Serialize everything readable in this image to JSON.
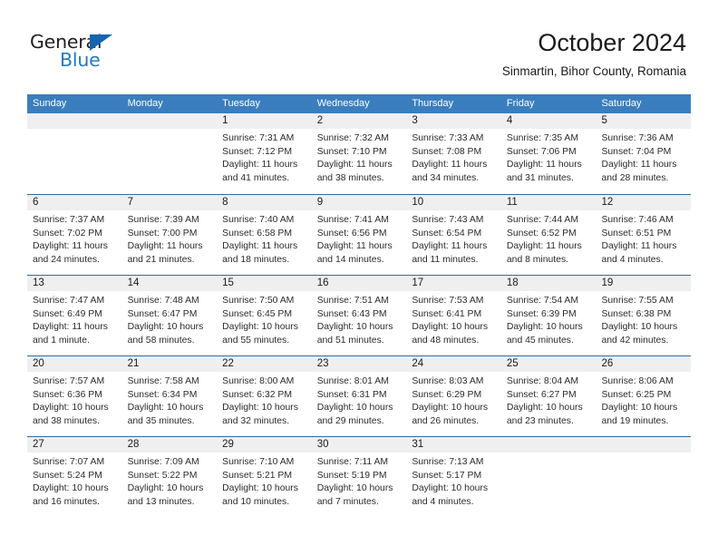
{
  "brand": {
    "name_top": "General",
    "name_bottom": "Blue",
    "color_dark": "#231f20",
    "color_blue": "#1f7ac4",
    "triangle_color": "#1566ae"
  },
  "header": {
    "title": "October 2024",
    "subtitle": "Sinmartin, Bihor County, Romania"
  },
  "theme": {
    "header_blue": "#3a7ebf",
    "row_separator_blue": "#2e6ca4",
    "daynum_band_gray": "#efefef"
  },
  "weekdays": [
    "Sunday",
    "Monday",
    "Tuesday",
    "Wednesday",
    "Thursday",
    "Friday",
    "Saturday"
  ],
  "weeks": [
    [
      {
        "day": "",
        "sunrise": "",
        "sunset": "",
        "daylight_1": "",
        "daylight_2": ""
      },
      {
        "day": "",
        "sunrise": "",
        "sunset": "",
        "daylight_1": "",
        "daylight_2": ""
      },
      {
        "day": "1",
        "sunrise": "Sunrise: 7:31 AM",
        "sunset": "Sunset: 7:12 PM",
        "daylight_1": "Daylight: 11 hours",
        "daylight_2": "and 41 minutes."
      },
      {
        "day": "2",
        "sunrise": "Sunrise: 7:32 AM",
        "sunset": "Sunset: 7:10 PM",
        "daylight_1": "Daylight: 11 hours",
        "daylight_2": "and 38 minutes."
      },
      {
        "day": "3",
        "sunrise": "Sunrise: 7:33 AM",
        "sunset": "Sunset: 7:08 PM",
        "daylight_1": "Daylight: 11 hours",
        "daylight_2": "and 34 minutes."
      },
      {
        "day": "4",
        "sunrise": "Sunrise: 7:35 AM",
        "sunset": "Sunset: 7:06 PM",
        "daylight_1": "Daylight: 11 hours",
        "daylight_2": "and 31 minutes."
      },
      {
        "day": "5",
        "sunrise": "Sunrise: 7:36 AM",
        "sunset": "Sunset: 7:04 PM",
        "daylight_1": "Daylight: 11 hours",
        "daylight_2": "and 28 minutes."
      }
    ],
    [
      {
        "day": "6",
        "sunrise": "Sunrise: 7:37 AM",
        "sunset": "Sunset: 7:02 PM",
        "daylight_1": "Daylight: 11 hours",
        "daylight_2": "and 24 minutes."
      },
      {
        "day": "7",
        "sunrise": "Sunrise: 7:39 AM",
        "sunset": "Sunset: 7:00 PM",
        "daylight_1": "Daylight: 11 hours",
        "daylight_2": "and 21 minutes."
      },
      {
        "day": "8",
        "sunrise": "Sunrise: 7:40 AM",
        "sunset": "Sunset: 6:58 PM",
        "daylight_1": "Daylight: 11 hours",
        "daylight_2": "and 18 minutes."
      },
      {
        "day": "9",
        "sunrise": "Sunrise: 7:41 AM",
        "sunset": "Sunset: 6:56 PM",
        "daylight_1": "Daylight: 11 hours",
        "daylight_2": "and 14 minutes."
      },
      {
        "day": "10",
        "sunrise": "Sunrise: 7:43 AM",
        "sunset": "Sunset: 6:54 PM",
        "daylight_1": "Daylight: 11 hours",
        "daylight_2": "and 11 minutes."
      },
      {
        "day": "11",
        "sunrise": "Sunrise: 7:44 AM",
        "sunset": "Sunset: 6:52 PM",
        "daylight_1": "Daylight: 11 hours",
        "daylight_2": "and 8 minutes."
      },
      {
        "day": "12",
        "sunrise": "Sunrise: 7:46 AM",
        "sunset": "Sunset: 6:51 PM",
        "daylight_1": "Daylight: 11 hours",
        "daylight_2": "and 4 minutes."
      }
    ],
    [
      {
        "day": "13",
        "sunrise": "Sunrise: 7:47 AM",
        "sunset": "Sunset: 6:49 PM",
        "daylight_1": "Daylight: 11 hours",
        "daylight_2": "and 1 minute."
      },
      {
        "day": "14",
        "sunrise": "Sunrise: 7:48 AM",
        "sunset": "Sunset: 6:47 PM",
        "daylight_1": "Daylight: 10 hours",
        "daylight_2": "and 58 minutes."
      },
      {
        "day": "15",
        "sunrise": "Sunrise: 7:50 AM",
        "sunset": "Sunset: 6:45 PM",
        "daylight_1": "Daylight: 10 hours",
        "daylight_2": "and 55 minutes."
      },
      {
        "day": "16",
        "sunrise": "Sunrise: 7:51 AM",
        "sunset": "Sunset: 6:43 PM",
        "daylight_1": "Daylight: 10 hours",
        "daylight_2": "and 51 minutes."
      },
      {
        "day": "17",
        "sunrise": "Sunrise: 7:53 AM",
        "sunset": "Sunset: 6:41 PM",
        "daylight_1": "Daylight: 10 hours",
        "daylight_2": "and 48 minutes."
      },
      {
        "day": "18",
        "sunrise": "Sunrise: 7:54 AM",
        "sunset": "Sunset: 6:39 PM",
        "daylight_1": "Daylight: 10 hours",
        "daylight_2": "and 45 minutes."
      },
      {
        "day": "19",
        "sunrise": "Sunrise: 7:55 AM",
        "sunset": "Sunset: 6:38 PM",
        "daylight_1": "Daylight: 10 hours",
        "daylight_2": "and 42 minutes."
      }
    ],
    [
      {
        "day": "20",
        "sunrise": "Sunrise: 7:57 AM",
        "sunset": "Sunset: 6:36 PM",
        "daylight_1": "Daylight: 10 hours",
        "daylight_2": "and 38 minutes."
      },
      {
        "day": "21",
        "sunrise": "Sunrise: 7:58 AM",
        "sunset": "Sunset: 6:34 PM",
        "daylight_1": "Daylight: 10 hours",
        "daylight_2": "and 35 minutes."
      },
      {
        "day": "22",
        "sunrise": "Sunrise: 8:00 AM",
        "sunset": "Sunset: 6:32 PM",
        "daylight_1": "Daylight: 10 hours",
        "daylight_2": "and 32 minutes."
      },
      {
        "day": "23",
        "sunrise": "Sunrise: 8:01 AM",
        "sunset": "Sunset: 6:31 PM",
        "daylight_1": "Daylight: 10 hours",
        "daylight_2": "and 29 minutes."
      },
      {
        "day": "24",
        "sunrise": "Sunrise: 8:03 AM",
        "sunset": "Sunset: 6:29 PM",
        "daylight_1": "Daylight: 10 hours",
        "daylight_2": "and 26 minutes."
      },
      {
        "day": "25",
        "sunrise": "Sunrise: 8:04 AM",
        "sunset": "Sunset: 6:27 PM",
        "daylight_1": "Daylight: 10 hours",
        "daylight_2": "and 23 minutes."
      },
      {
        "day": "26",
        "sunrise": "Sunrise: 8:06 AM",
        "sunset": "Sunset: 6:25 PM",
        "daylight_1": "Daylight: 10 hours",
        "daylight_2": "and 19 minutes."
      }
    ],
    [
      {
        "day": "27",
        "sunrise": "Sunrise: 7:07 AM",
        "sunset": "Sunset: 5:24 PM",
        "daylight_1": "Daylight: 10 hours",
        "daylight_2": "and 16 minutes."
      },
      {
        "day": "28",
        "sunrise": "Sunrise: 7:09 AM",
        "sunset": "Sunset: 5:22 PM",
        "daylight_1": "Daylight: 10 hours",
        "daylight_2": "and 13 minutes."
      },
      {
        "day": "29",
        "sunrise": "Sunrise: 7:10 AM",
        "sunset": "Sunset: 5:21 PM",
        "daylight_1": "Daylight: 10 hours",
        "daylight_2": "and 10 minutes."
      },
      {
        "day": "30",
        "sunrise": "Sunrise: 7:11 AM",
        "sunset": "Sunset: 5:19 PM",
        "daylight_1": "Daylight: 10 hours",
        "daylight_2": "and 7 minutes."
      },
      {
        "day": "31",
        "sunrise": "Sunrise: 7:13 AM",
        "sunset": "Sunset: 5:17 PM",
        "daylight_1": "Daylight: 10 hours",
        "daylight_2": "and 4 minutes."
      },
      {
        "day": "",
        "sunrise": "",
        "sunset": "",
        "daylight_1": "",
        "daylight_2": ""
      },
      {
        "day": "",
        "sunrise": "",
        "sunset": "",
        "daylight_1": "",
        "daylight_2": ""
      }
    ]
  ]
}
